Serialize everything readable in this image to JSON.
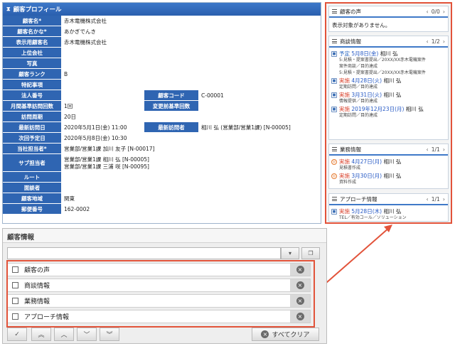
{
  "profile": {
    "title": "顧客プロフィール",
    "rows": [
      {
        "label": "顧客名*",
        "value": "赤木電機株式会社"
      },
      {
        "label": "顧客名かな*",
        "value": "あかぎでんき"
      },
      {
        "label": "表示用顧客名",
        "value": "赤木電機株式会社"
      },
      {
        "label": "上位会社",
        "value": ""
      },
      {
        "label": "写真",
        "value": ""
      },
      {
        "label": "顧客ランク",
        "value": "B"
      },
      {
        "label": "特記事項",
        "value": ""
      },
      {
        "label": "法人番号",
        "value": ""
      },
      {
        "label": "月間基準訪問回数",
        "value": "1回"
      },
      {
        "label": "訪問周期",
        "value": "20日"
      },
      {
        "label": "最新訪問日",
        "value": "2020年5月1日(金) 11:00"
      },
      {
        "label": "次回予定日",
        "value": "2020年5月8日(金) 10:30"
      },
      {
        "label": "当社担当者*",
        "value": "営業部/営業1課 加川 友子 [N-00017]"
      },
      {
        "label": "サブ担当者",
        "value": "営業部/営業1課 相川 弘 [N-00005]",
        "value2": "営業部/営業1課 三浦 咲 [N-00095]"
      },
      {
        "label": "ルート",
        "value": ""
      },
      {
        "label": "面談者",
        "value": ""
      },
      {
        "label": "顧客地域",
        "value": "関東"
      },
      {
        "label": "郵便番号",
        "value": "162-0002"
      }
    ],
    "side": [
      {
        "label": "顧客コード",
        "value": "C-00001"
      },
      {
        "label": "変更前基準回数",
        "value": ""
      },
      {
        "label": "最新訪問者",
        "value": "相川 弘 (営業部/営業1課) [N-00005]"
      }
    ]
  },
  "timeline": {
    "voice": {
      "title": "顧客の声",
      "count": "0/0",
      "empty": "表示対象がありません。"
    },
    "deals": {
      "title": "商談情報",
      "count": "1/2",
      "entries": [
        {
          "status": "予定",
          "date": "5月8日(金)",
          "person": "相川 弘",
          "sub1": "5:見積・提案書提出／20XX/XX赤木電機案件",
          "sub2": "案件商談／目的達成",
          "sub3": "5:見積・提案書提出／20XX/XX赤木電機案件",
          "icon": "box"
        },
        {
          "status": "実施",
          "date": "4月28日(火)",
          "person": "相川 弘",
          "sub1": "定期訪問／目的達成",
          "icon": "box"
        },
        {
          "status": "実施",
          "date": "3月31日(火)",
          "person": "相川 弘",
          "sub1": "情報提供／目的達成",
          "icon": "box"
        },
        {
          "status": "実施",
          "date": "2019年12月23日(月)",
          "person": "相川 弘",
          "sub1": "定期訪問／目的達成",
          "icon": "box"
        }
      ]
    },
    "work": {
      "title": "業務情報",
      "count": "1/1",
      "entries": [
        {
          "status": "実施",
          "date": "4月27日(月)",
          "person": "相川 弘",
          "sub1": "見積書作成"
        },
        {
          "status": "実施",
          "date": "3月30日(月)",
          "person": "相川 弘",
          "sub1": "資料作成"
        }
      ]
    },
    "approach": {
      "title": "アプローチ情報",
      "count": "1/1",
      "entries": [
        {
          "status": "実施",
          "date": "5月28日(木)",
          "person": "相川 弘",
          "sub1": "TEL／有効コール／ソリューション"
        }
      ]
    }
  },
  "customer_info": {
    "title": "顧客情報",
    "items": [
      "顧客の声",
      "商談情報",
      "業務情報",
      "アプローチ情報"
    ],
    "clear_label": "すべてクリア"
  },
  "colors": {
    "header_blue": "#2f65b2",
    "highlight": "#e2533a",
    "status_red": "#d9402b",
    "date_blue": "#2357c4"
  }
}
